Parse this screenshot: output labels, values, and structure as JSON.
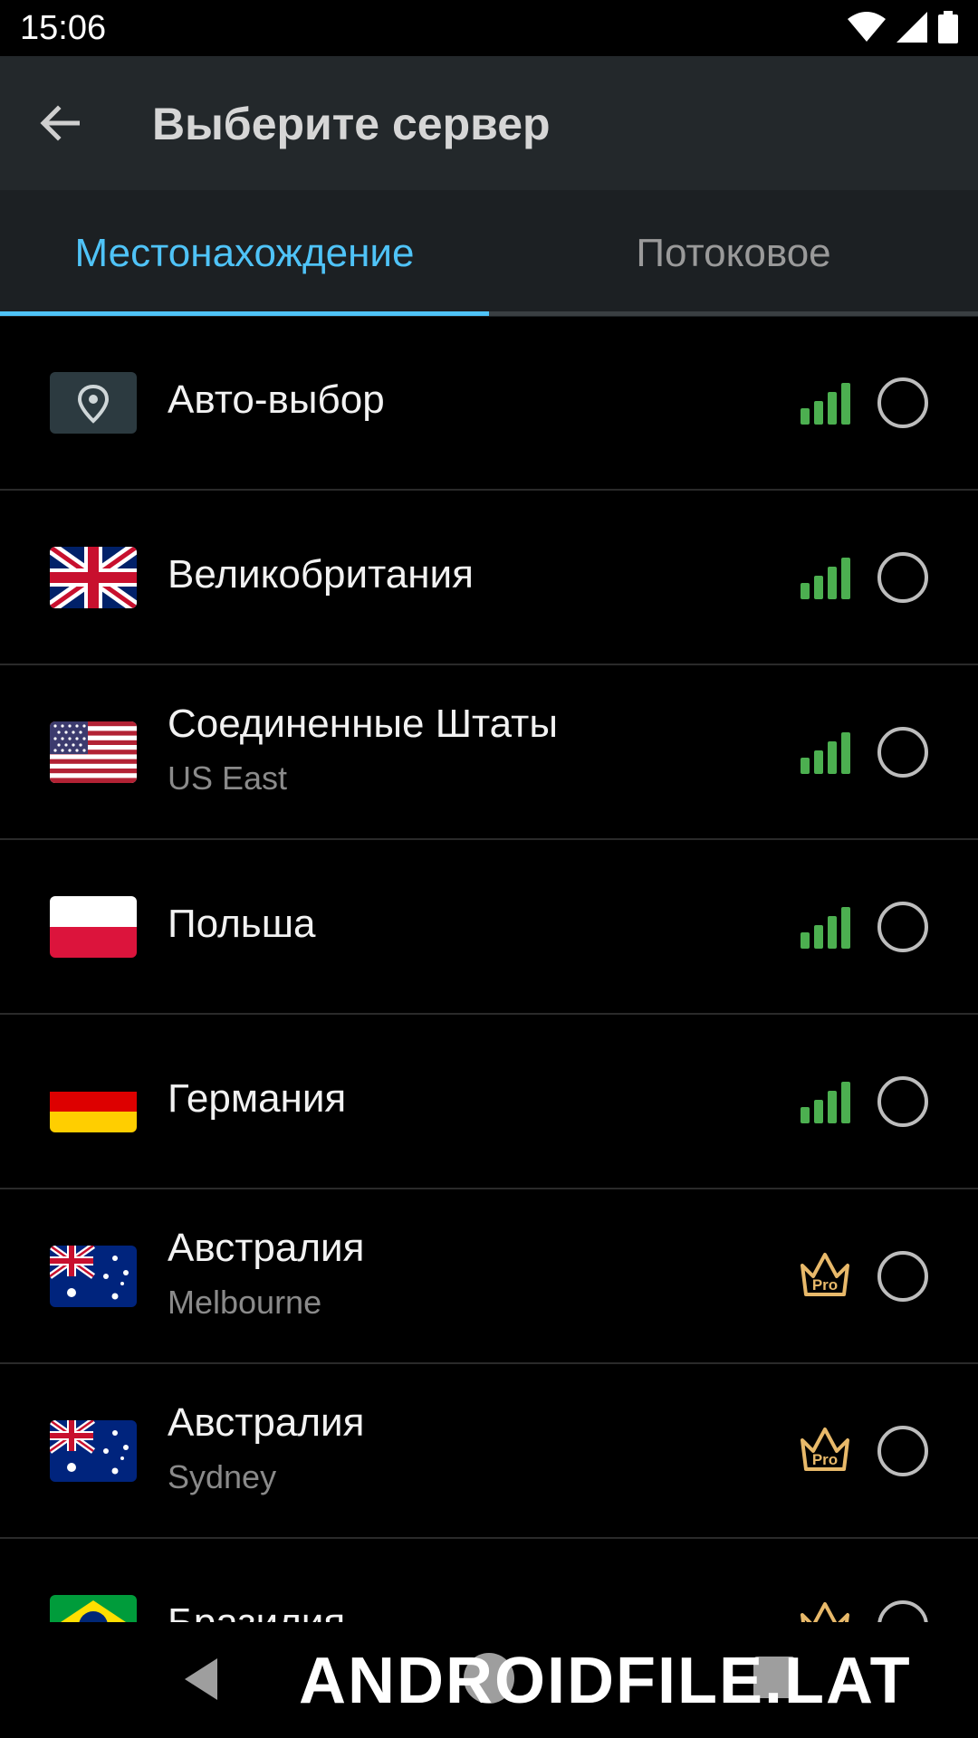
{
  "status_bar": {
    "time": "15:06",
    "icons": [
      "wifi-icon",
      "cell-signal-icon",
      "battery-icon"
    ]
  },
  "app_bar": {
    "title": "Выберите сервер",
    "back_icon": "arrow-left-icon"
  },
  "tabs": [
    {
      "label": "Местонахождение",
      "active": true
    },
    {
      "label": "Потоковое",
      "active": false
    }
  ],
  "colors": {
    "accent": "#4fc3f7",
    "signal": "#4caf50",
    "pro": "#e8b96a",
    "appbar": "#23282b",
    "tabs_bg": "#1c2023"
  },
  "servers": [
    {
      "name": "Авто-выбор",
      "sub": "",
      "flag": "location-pin",
      "badge": "signal",
      "selected": false
    },
    {
      "name": "Великобритания",
      "sub": "",
      "flag": "uk",
      "badge": "signal",
      "selected": false
    },
    {
      "name": "Соединенные Штаты",
      "sub": "US East",
      "flag": "us",
      "badge": "signal",
      "selected": false
    },
    {
      "name": "Польша",
      "sub": "",
      "flag": "pl",
      "badge": "signal",
      "selected": false
    },
    {
      "name": "Германия",
      "sub": "",
      "flag": "de",
      "badge": "signal",
      "selected": false
    },
    {
      "name": "Австралия",
      "sub": "Melbourne",
      "flag": "au",
      "badge": "pro",
      "selected": false
    },
    {
      "name": "Австралия",
      "sub": "Sydney",
      "flag": "au",
      "badge": "pro",
      "selected": false
    },
    {
      "name": "Бразилия",
      "sub": "",
      "flag": "br",
      "badge": "pro",
      "selected": false
    }
  ],
  "pro_label": "Pro",
  "watermark": "ANDROIDFILE.LAT"
}
